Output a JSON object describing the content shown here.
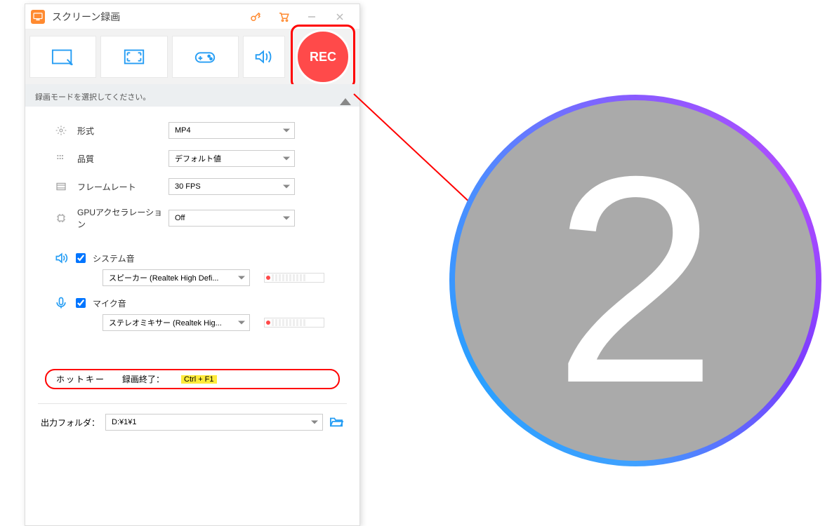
{
  "titlebar": {
    "title": "スクリーン録画"
  },
  "rec": {
    "label": "REC"
  },
  "hint": {
    "text": "録画モードを選択してください。"
  },
  "settings": {
    "format": {
      "label": "形式",
      "value": "MP4"
    },
    "quality": {
      "label": "品質",
      "value": "デフォルト値"
    },
    "fps": {
      "label": "フレームレート",
      "value": "30 FPS"
    },
    "gpu": {
      "label": "GPUアクセラレーション",
      "value": "Off"
    }
  },
  "audio": {
    "system": {
      "label": "システム音",
      "device": "スピーカー (Realtek High Defi..."
    },
    "mic": {
      "label": "マイク音",
      "device": "ステレオミキサー (Realtek Hig..."
    }
  },
  "hotkey": {
    "label": "ホットキー",
    "stop_label": "録画終了：",
    "stop_key": "Ctrl + F1"
  },
  "output": {
    "label": "出力フォルダ：",
    "path": "D:¥1¥1"
  },
  "countdown": {
    "value": "2"
  }
}
